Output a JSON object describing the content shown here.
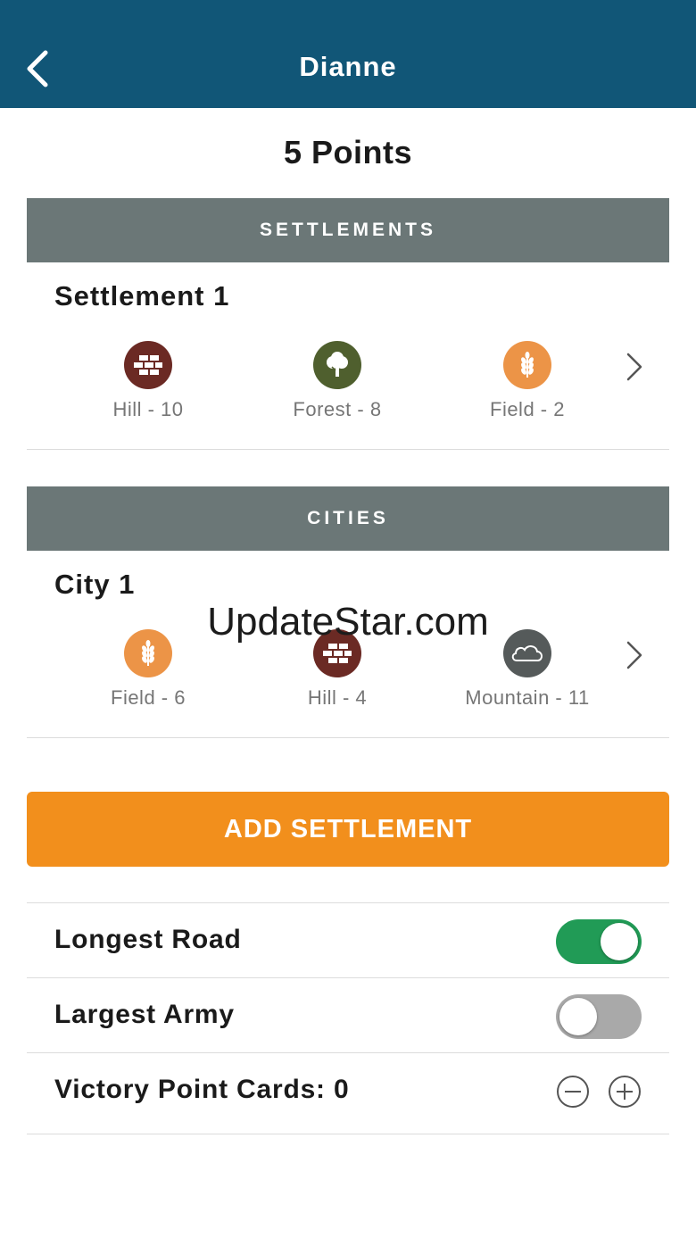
{
  "header": {
    "title": "Dianne",
    "back_icon": "chevron-left-icon"
  },
  "points_label": "5 Points",
  "settlements": {
    "header": "SETTLEMENTS",
    "items": [
      {
        "title": "Settlement 1",
        "tiles": [
          {
            "label": "Hill - 10",
            "icon": "brick-icon",
            "color": "#6b2a24"
          },
          {
            "label": "Forest - 8",
            "icon": "tree-icon",
            "color": "#4f5f2e"
          },
          {
            "label": "Field - 2",
            "icon": "wheat-icon",
            "color": "#ec9447"
          }
        ]
      }
    ]
  },
  "cities": {
    "header": "CITIES",
    "items": [
      {
        "title": "City 1",
        "tiles": [
          {
            "label": "Field - 6",
            "icon": "wheat-icon",
            "color": "#ec9447"
          },
          {
            "label": "Hill - 4",
            "icon": "brick-icon",
            "color": "#6b2a24"
          },
          {
            "label": "Mountain - 11",
            "icon": "cloud-icon",
            "color": "#555a5a"
          }
        ]
      }
    ]
  },
  "watermark": "UpdateStar.com",
  "add_button_label": "ADD SETTLEMENT",
  "options": {
    "longest_road": {
      "label": "Longest Road",
      "enabled": true
    },
    "largest_army": {
      "label": "Largest Army",
      "enabled": false
    },
    "victory_cards": {
      "label": "Victory Point Cards: 0"
    }
  },
  "colors": {
    "header_bg": "#115677",
    "section_bg": "#6b7777",
    "accent": "#f28f1c",
    "toggle_on": "#219b56",
    "toggle_off": "#a9a9a9"
  }
}
